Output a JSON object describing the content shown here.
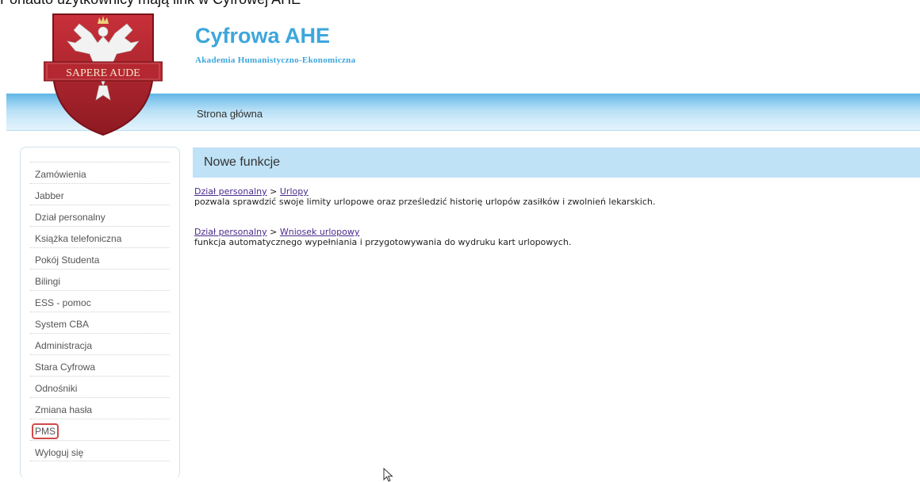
{
  "top_line": {
    "text": "Ponadto użytkownicy mają link w Cyfrowej AHE",
    "link": "Cyfrowa AHE"
  },
  "logo": {
    "motto": "SAPERE AUDE"
  },
  "header": {
    "title": "Cyfrowa AHE",
    "subtitle": "Akademia Humanistyczno-Ekonomiczna"
  },
  "nav": {
    "home": "Strona główna"
  },
  "sidebar": {
    "items": [
      {
        "label": "Zamówienia"
      },
      {
        "label": "Jabber"
      },
      {
        "label": "Dział personalny"
      },
      {
        "label": "Książka telefoniczna"
      },
      {
        "label": "Pokój Studenta"
      },
      {
        "label": "Bilingi"
      },
      {
        "label": "ESS - pomoc"
      },
      {
        "label": "System CBA"
      },
      {
        "label": "Administracja"
      },
      {
        "label": "Stara Cyfrowa"
      },
      {
        "label": "Odnośniki"
      },
      {
        "label": "Zmiana hasła"
      },
      {
        "label": "PMS"
      },
      {
        "label": "Wyloguj się"
      }
    ]
  },
  "content": {
    "heading": "Nowe funkcje",
    "entries": [
      {
        "section": "Dział personalny",
        "separator": ">",
        "link": "Urlopy",
        "description": "pozwala sprawdzić swoje limity urlopowe oraz prześledzić historię urlopów zasiłków i zwolnień lekarskich."
      },
      {
        "section": "Dział personalny",
        "separator": ">",
        "link": "Wniosek urlopowy",
        "description": "funkcja automatycznego wypełniania i przygotowywania do wydruku kart urlopowych."
      }
    ]
  },
  "colors": {
    "title": "#3da6dc",
    "nav_bar": "#8ccbef",
    "content_header": "#bfe2f6",
    "shield": "#b8262e",
    "pms_highlight": "#d24a4a"
  }
}
